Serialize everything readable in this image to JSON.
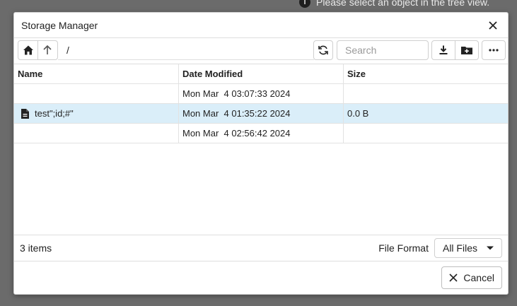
{
  "background": {
    "message": "Please select an object in the tree view.",
    "icon": "info-icon"
  },
  "dialog": {
    "title": "Storage Manager",
    "close_icon": "close-icon"
  },
  "toolbar": {
    "home_icon": "home-icon",
    "up_icon": "arrow-up-icon",
    "path_value": "/",
    "refresh_icon": "refresh-icon",
    "search_placeholder": "Search",
    "download_icon": "download-icon",
    "new_folder_icon": "folder-plus-icon",
    "more_icon": "more-horizontal-icon"
  },
  "table": {
    "columns": [
      "Name",
      "Date Modified",
      "Size"
    ],
    "rows": [
      {
        "name": "",
        "icon": "",
        "date": "Mon Mar  4 03:07:33 2024",
        "size": "",
        "selected": false
      },
      {
        "name": "test\";id;#\"",
        "icon": "file-icon",
        "date": "Mon Mar  4 01:35:22 2024",
        "size": "0.0 B",
        "selected": true
      },
      {
        "name": "",
        "icon": "",
        "date": "Mon Mar  4 02:56:42 2024",
        "size": "",
        "selected": false
      }
    ]
  },
  "status": {
    "item_count": "3 items",
    "file_format_label": "File Format",
    "file_format_value": "All Files"
  },
  "footer": {
    "cancel_label": "Cancel"
  },
  "colors": {
    "selected_row": "#daeef9",
    "backdrop": "#6b6b6b"
  }
}
